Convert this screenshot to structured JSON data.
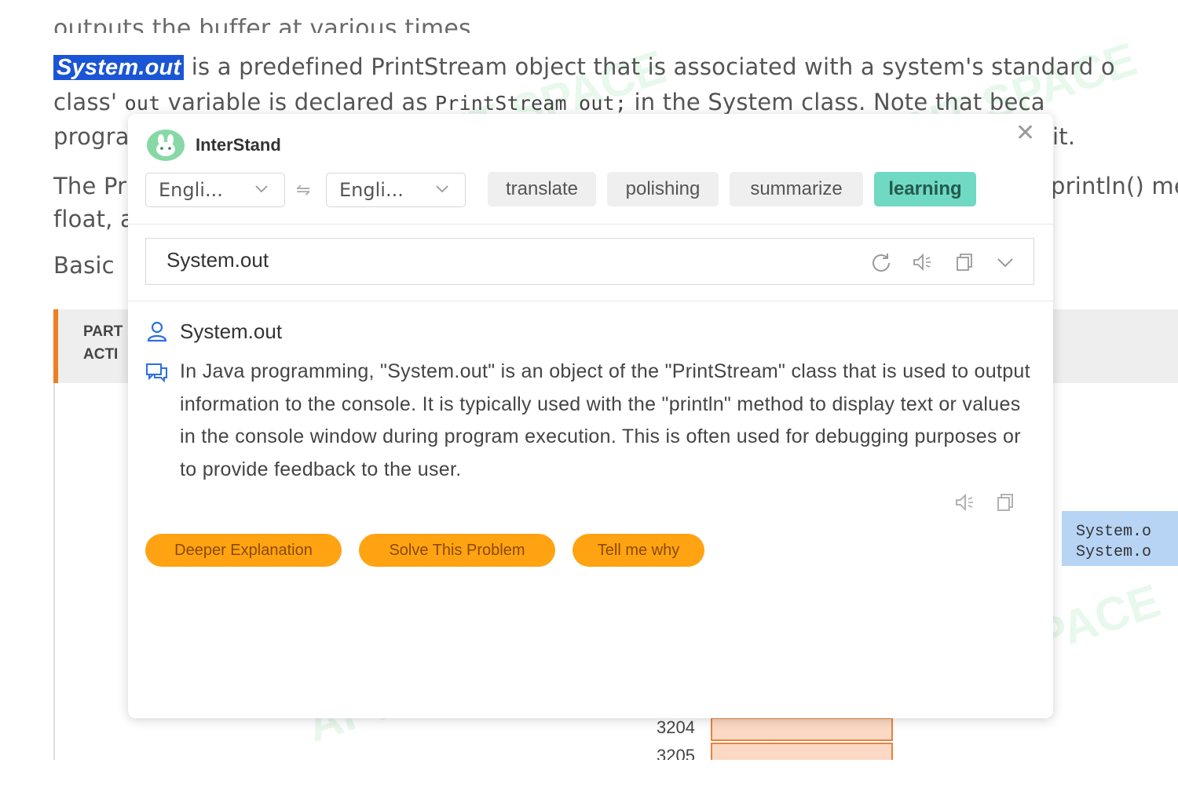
{
  "background": {
    "cut_line": "outputs the buffer at various times.",
    "para1": {
      "highlight": "System.out",
      "line1_rest": " is a predefined PrintStream object that is associated with a system's standard o",
      "line2_a": "class' ",
      "line2_code1": "out",
      "line2_b": " variable is declared as ",
      "line2_code2": "PrintStream out;",
      "line2_c": " in the System class. Note that beca",
      "line3_a": "progra",
      "line3_b": "it."
    },
    "para2": {
      "line1_a": "The Pr",
      "line1_b": "println() me",
      "line2": "float, a"
    },
    "basic": "Basic",
    "part_label_1": "PART",
    "part_label_2": "ACTI",
    "code_lines": [
      "System.o",
      "System.o"
    ],
    "addresses": [
      "3204",
      "3205"
    ],
    "watermark": "AI TALENT SPACE"
  },
  "popup": {
    "brand": "InterStand",
    "source_lang": "Engli...",
    "target_lang": "Engli...",
    "swap_symbol": "⇋",
    "modes": [
      {
        "label": "translate",
        "active": false
      },
      {
        "label": "polishing",
        "active": false
      },
      {
        "label": "summarize",
        "active": false
      },
      {
        "label": "learning",
        "active": true
      }
    ],
    "input_value": "System.out",
    "result": {
      "word": "System.out",
      "explanation": "In Java programming, \"System.out\" is an object of the \"PrintStream\" class that is used to output information to the console. It is typically used with the \"println\" method to display text or values in the console window during program execution. This is often used for debugging purposes or to provide feedback to the user."
    },
    "actions": [
      "Deeper Explanation",
      "Solve This Problem",
      "Tell me why"
    ]
  },
  "colors": {
    "accent_active_mode": "#6fd9c4",
    "action_button": "#ffa312",
    "selection_highlight": "#1a55d6",
    "icon_blue": "#2d6fe0"
  },
  "icons": [
    "close-icon",
    "bunny-logo-icon",
    "chevron-down-icon",
    "swap-icon",
    "refresh-icon",
    "speaker-icon",
    "copy-icon",
    "user-icon",
    "chat-icon"
  ]
}
